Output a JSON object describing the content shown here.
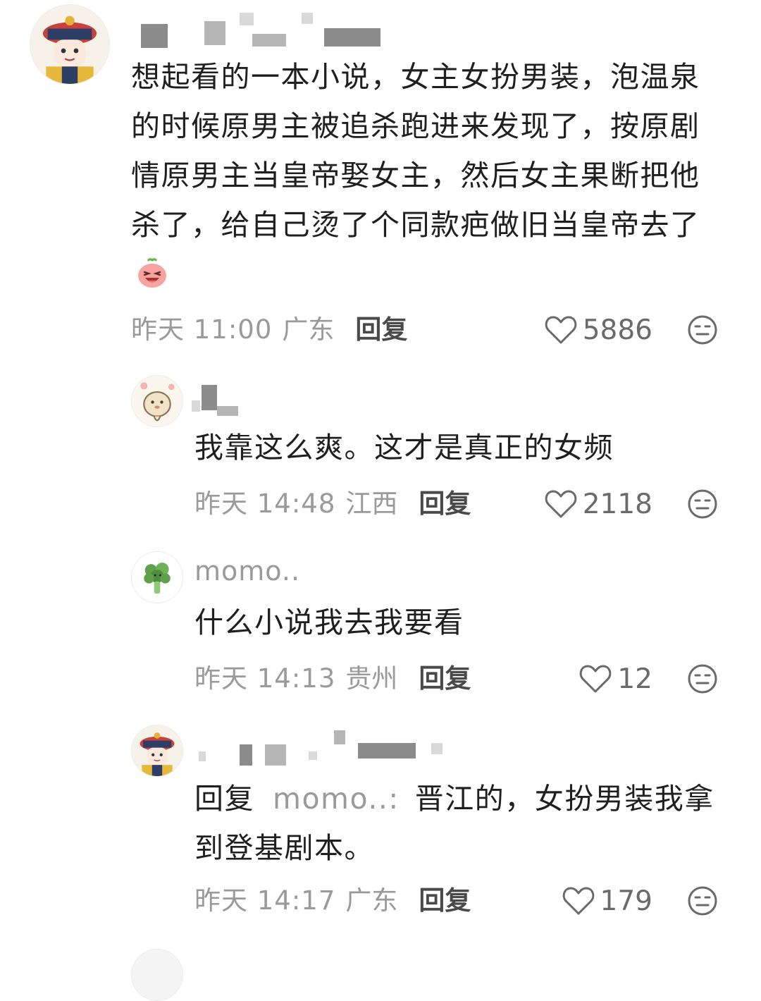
{
  "comments": [
    {
      "username": "",
      "text": "想起看的一本小说，女主女扮男装，泡温泉的时候原男主被追杀跑进来发现了，按原剧情原男主当皇帝娶女主，然后女主果断把他杀了，给自己烫了个同款疤做旧当皇帝去了",
      "emoji_icon": "laughing-peach-emoji",
      "time": "昨天 11:00",
      "location": "广东",
      "reply_label": "回复",
      "likes": "5886",
      "avatar_icon": "qing-official-avatar"
    },
    {
      "username": "",
      "text": "我靠这么爽。这才是真正的女频",
      "time": "昨天 14:48",
      "location": "江西",
      "reply_label": "回复",
      "likes": "2118",
      "avatar_icon": "hamster-avatar"
    },
    {
      "username": "momo..",
      "text": "什么小说我去我要看",
      "time": "昨天 14:13",
      "location": "贵州",
      "reply_label": "回复",
      "likes": "12",
      "avatar_icon": "broccoli-avatar"
    },
    {
      "username": "",
      "reply_prefix": "回复",
      "reply_target": "momo..",
      "reply_colon": ":",
      "text": "晋江的，女扮男装我拿到登基剧本。",
      "time": "昨天 14:17",
      "location": "广东",
      "reply_label": "回复",
      "likes": "179",
      "avatar_icon": "qing-official-avatar"
    }
  ],
  "icons": {
    "like": "heart-outline-icon",
    "dislike": "meh-face-icon"
  },
  "colors": {
    "text": "#1f1f1f",
    "meta": "#9a9a9a",
    "reply_button": "#4a4a4a"
  }
}
